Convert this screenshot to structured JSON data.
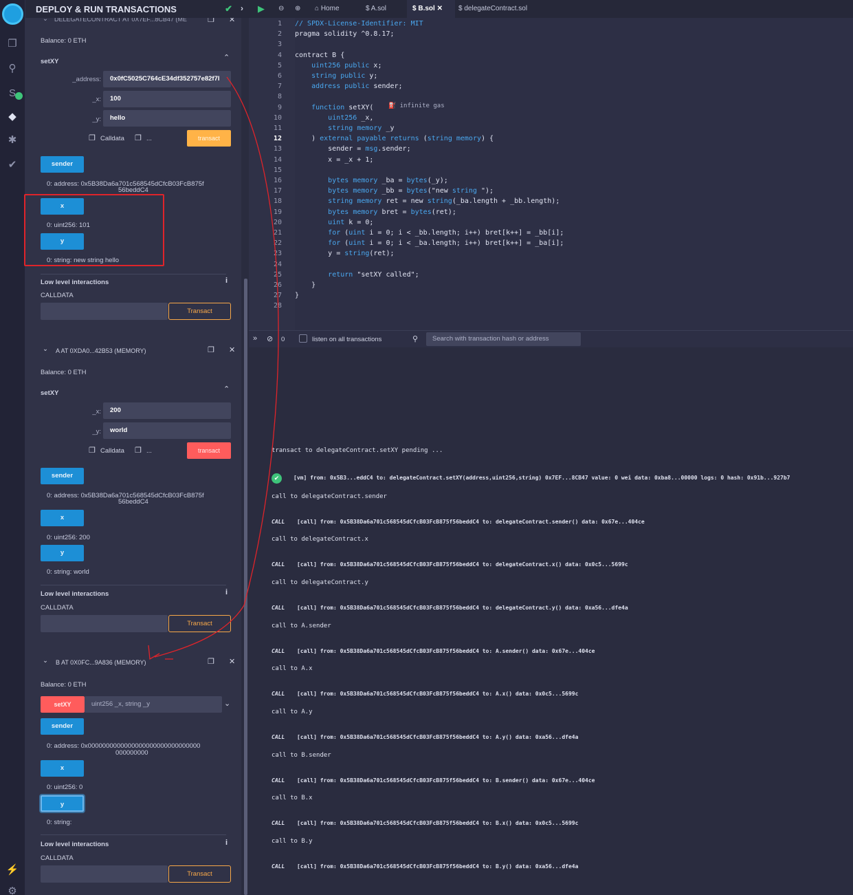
{
  "panel": {
    "title": "DEPLOY & RUN TRANSACTIONS",
    "top_contract_header": "DELEGATECONTRACT AT 0X7EF...8CB47 (ME"
  },
  "contract1": {
    "balance": "Balance: 0 ETH",
    "fn_name": "setXY",
    "address_label": "_address:",
    "address_value": "0x0fC5025C764cE34df352757e82f7I",
    "x_label": "_x:",
    "x_value": "100",
    "y_label": "_y:",
    "y_value": "hello",
    "calldata": "Calldata",
    "dots": "...",
    "transact": "transact",
    "sender_btn": "sender",
    "sender_out_1": "0: address: 0x5B38Da6a701c568545dCfcB03FcB875f",
    "sender_out_2": "56beddC4",
    "x_btn": "x",
    "x_out": "0: uint256: 101",
    "y_btn": "y",
    "y_out": "0: string: new string hello",
    "low_level": "Low level interactions",
    "calldata_caps": "CALLDATA",
    "transact_btn": "Transact"
  },
  "contract2": {
    "header": "A AT 0XDA0...42B53 (MEMORY)",
    "balance": "Balance: 0 ETH",
    "fn_name": "setXY",
    "x_label": "_x:",
    "x_value": "200",
    "y_label": "_y:",
    "y_value": "world",
    "calldata": "Calldata",
    "dots": "...",
    "transact": "transact",
    "sender_btn": "sender",
    "sender_out_1": "0: address: 0x5B38Da6a701c568545dCfcB03FcB875f",
    "sender_out_2": "56beddC4",
    "x_btn": "x",
    "x_out": "0: uint256: 200",
    "y_btn": "y",
    "y_out": "0: string: world",
    "low_level": "Low level interactions",
    "calldata_caps": "CALLDATA",
    "transact_btn": "Transact"
  },
  "contract3": {
    "header": "B AT 0X0FC...9A836 (MEMORY)",
    "balance": "Balance: 0 ETH",
    "setxy_btn": "setXY",
    "setxy_placeholder": "uint256 _x, string _y",
    "sender_btn": "sender",
    "sender_out_1": "0: address: 0x0000000000000000000000000000000",
    "sender_out_2": "000000000",
    "x_btn": "x",
    "x_out": "0: uint256: 0",
    "y_btn": "y",
    "y_out": "0: string:",
    "low_level": "Low level interactions",
    "calldata_caps": "CALLDATA",
    "transact_btn": "Transact"
  },
  "tabs": [
    {
      "label": "Home"
    },
    {
      "label": "A.sol"
    },
    {
      "label": "B.sol"
    },
    {
      "label": "delegateContract.sol"
    }
  ],
  "code_lines": [
    "// SPDX-License-Identifier: MIT",
    "pragma solidity ^0.8.17;",
    "",
    "contract B {",
    "    uint256 public x;",
    "    string public y;",
    "    address public sender;",
    "",
    "    function setXY(",
    "        uint256 _x,",
    "        string memory _y",
    "    ) external payable returns (string memory) {",
    "        sender = msg.sender;",
    "        x = _x + 1;",
    "",
    "        bytes memory _ba = bytes(_y);",
    "        bytes memory _bb = bytes(\"new string \");",
    "        string memory ret = new string(_ba.length + _bb.length);",
    "        bytes memory bret = bytes(ret);",
    "        uint k = 0;",
    "        for (uint i = 0; i < _bb.length; i++) bret[k++] = _bb[i];",
    "        for (uint i = 0; i < _ba.length; i++) bret[k++] = _ba[i];",
    "        y = string(ret);",
    "",
    "        return \"setXY called\";",
    "    }",
    "}",
    ""
  ],
  "gas_hint": "infinite gas",
  "terminal": {
    "count": "0",
    "listen_label": "listen on all transactions",
    "search_placeholder": "Search with transaction hash or address",
    "pending": "transact to delegateContract.setXY pending ...",
    "vm_line": "[vm]  from: 0x5B3...eddC4 to: delegateContract.setXY(address,uint256,string) 0x7EF...8CB47 value: 0 wei data: 0xba8...00000 logs: 0 hash: 0x91b...927b7",
    "entries": [
      {
        "call_to": "call to delegateContract.sender",
        "detail": "[call]  from: 0x5B38Da6a701c568545dCfcB03FcB875f56beddC4 to: delegateContract.sender() data: 0x67e...404ce"
      },
      {
        "call_to": "call to delegateContract.x",
        "detail": "[call]  from: 0x5B38Da6a701c568545dCfcB03FcB875f56beddC4 to: delegateContract.x() data: 0x0c5...5699c"
      },
      {
        "call_to": "call to delegateContract.y",
        "detail": "[call]  from: 0x5B38Da6a701c568545dCfcB03FcB875f56beddC4 to: delegateContract.y() data: 0xa56...dfe4a"
      },
      {
        "call_to": "call to A.sender",
        "detail": "[call]  from: 0x5B38Da6a701c568545dCfcB03FcB875f56beddC4 to: A.sender() data: 0x67e...404ce"
      },
      {
        "call_to": "call to A.x",
        "detail": "[call]  from: 0x5B38Da6a701c568545dCfcB03FcB875f56beddC4 to: A.x() data: 0x0c5...5699c"
      },
      {
        "call_to": "call to A.y",
        "detail": "[call]  from: 0x5B38Da6a701c568545dCfcB03FcB875f56beddC4 to: A.y() data: 0xa56...dfe4a"
      },
      {
        "call_to": "call to B.sender",
        "detail": "[call]  from: 0x5B38Da6a701c568545dCfcB03FcB875f56beddC4 to: B.sender() data: 0x67e...404ce"
      },
      {
        "call_to": "call to B.x",
        "detail": "[call]  from: 0x5B38Da6a701c568545dCfcB03FcB875f56beddC4 to: B.x() data: 0x0c5...5699c"
      },
      {
        "call_to": "call to B.y",
        "detail": "[call]  from: 0x5B38Da6a701c568545dCfcB03FcB875f56beddC4 to: B.y() data: 0xa56...dfe4a"
      }
    ],
    "call_badge": "CALL"
  },
  "colors": {
    "accent_blue": "#1d8fd6",
    "orange": "#ffb347",
    "red": "#ff5c5c",
    "annotation_red": "#e0242a",
    "success_green": "#3ec47a"
  }
}
